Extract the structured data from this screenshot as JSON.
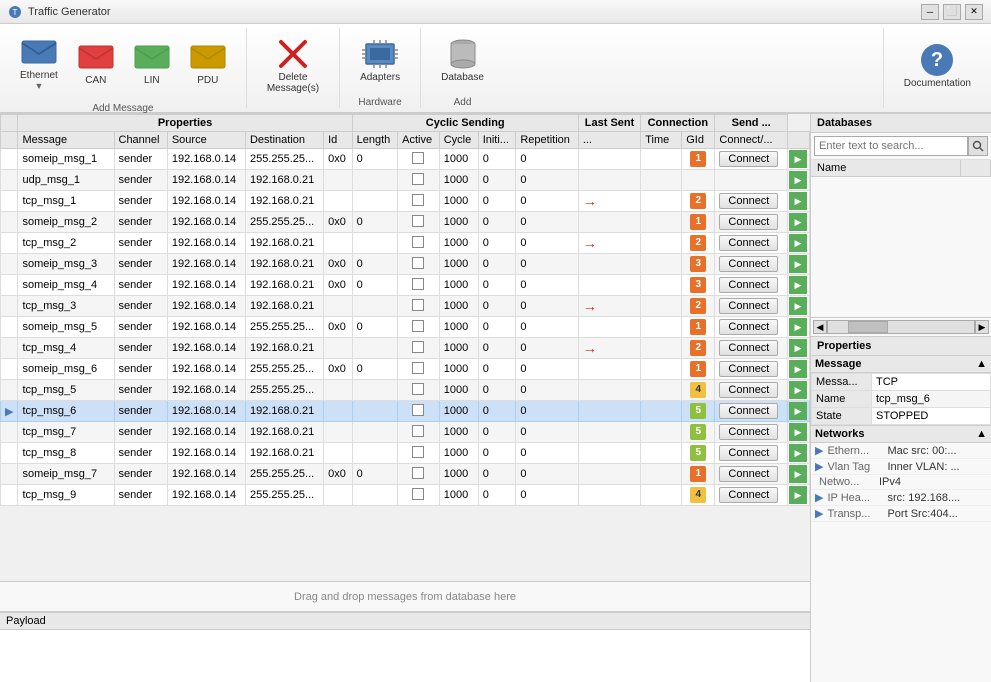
{
  "app": {
    "title": "Traffic Generator"
  },
  "toolbar": {
    "groups": [
      {
        "label": "Add Message",
        "items": [
          {
            "id": "ethernet",
            "label": "Ethernet",
            "icon": "envelope-blue"
          },
          {
            "id": "can",
            "label": "CAN",
            "icon": "envelope-red"
          },
          {
            "id": "lin",
            "label": "LIN",
            "icon": "envelope-green"
          },
          {
            "id": "pdu",
            "label": "PDU",
            "icon": "envelope-yellow"
          }
        ]
      },
      {
        "label": "",
        "items": [
          {
            "id": "delete",
            "label": "Delete\nMessage(s)",
            "icon": "delete-x"
          }
        ]
      },
      {
        "label": "Hardware",
        "items": [
          {
            "id": "adapters",
            "label": "Adapters",
            "icon": "adapters-chip"
          }
        ]
      },
      {
        "label": "Add",
        "items": [
          {
            "id": "database",
            "label": "Database",
            "icon": "database-cylinder"
          }
        ]
      }
    ],
    "docs_label": "Documentation"
  },
  "table": {
    "col_groups": [
      {
        "label": "Properties",
        "colspan": 5
      },
      {
        "label": "Cyclic Sending",
        "colspan": 5
      },
      {
        "label": "Last Sent",
        "colspan": 1
      },
      {
        "label": "Connection",
        "colspan": 2
      },
      {
        "label": "Send ...",
        "colspan": 1
      }
    ],
    "columns": [
      "Message",
      "Channel",
      "Source",
      "Destination",
      "Id",
      "Length",
      "Active",
      "Cycle",
      "Initi...",
      "Repetition",
      "...",
      "Time",
      "GId",
      "Connect/...",
      ""
    ],
    "rows": [
      {
        "name": "someip_msg_1",
        "channel": "sender",
        "src": "192.168.0.14",
        "dst": "255.255.25...",
        "id": "0x0",
        "length": "0",
        "active": false,
        "cycle": "1000",
        "init": "0",
        "rep": "0",
        "dot": "",
        "time": "",
        "gid": 1,
        "gid_class": "gid-1",
        "connect": true,
        "arrow": false,
        "selected": false
      },
      {
        "name": "udp_msg_1",
        "channel": "sender",
        "src": "192.168.0.14",
        "dst": "192.168.0.21",
        "id": "",
        "length": "",
        "active": false,
        "cycle": "1000",
        "init": "0",
        "rep": "0",
        "dot": "",
        "time": "",
        "gid": null,
        "gid_class": "",
        "connect": false,
        "arrow": false,
        "selected": false
      },
      {
        "name": "tcp_msg_1",
        "channel": "sender",
        "src": "192.168.0.14",
        "dst": "192.168.0.21",
        "id": "",
        "length": "",
        "active": false,
        "cycle": "1000",
        "init": "0",
        "rep": "0",
        "dot": "",
        "time": "",
        "gid": 2,
        "gid_class": "gid-2",
        "connect": true,
        "arrow": true,
        "selected": false
      },
      {
        "name": "someip_msg_2",
        "channel": "sender",
        "src": "192.168.0.14",
        "dst": "255.255.25...",
        "id": "0x0",
        "length": "0",
        "active": false,
        "cycle": "1000",
        "init": "0",
        "rep": "0",
        "dot": "",
        "time": "",
        "gid": 1,
        "gid_class": "gid-1",
        "connect": true,
        "arrow": false,
        "selected": false
      },
      {
        "name": "tcp_msg_2",
        "channel": "sender",
        "src": "192.168.0.14",
        "dst": "192.168.0.21",
        "id": "",
        "length": "",
        "active": false,
        "cycle": "1000",
        "init": "0",
        "rep": "0",
        "dot": "",
        "time": "",
        "gid": 2,
        "gid_class": "gid-2",
        "connect": true,
        "arrow": true,
        "selected": false
      },
      {
        "name": "someip_msg_3",
        "channel": "sender",
        "src": "192.168.0.14",
        "dst": "192.168.0.21",
        "id": "0x0",
        "length": "0",
        "active": false,
        "cycle": "1000",
        "init": "0",
        "rep": "0",
        "dot": "",
        "time": "",
        "gid": 3,
        "gid_class": "gid-3",
        "connect": true,
        "arrow": false,
        "selected": false
      },
      {
        "name": "someip_msg_4",
        "channel": "sender",
        "src": "192.168.0.14",
        "dst": "192.168.0.21",
        "id": "0x0",
        "length": "0",
        "active": false,
        "cycle": "1000",
        "init": "0",
        "rep": "0",
        "dot": "",
        "time": "",
        "gid": 3,
        "gid_class": "gid-3",
        "connect": true,
        "arrow": false,
        "selected": false
      },
      {
        "name": "tcp_msg_3",
        "channel": "sender",
        "src": "192.168.0.14",
        "dst": "192.168.0.21",
        "id": "",
        "length": "",
        "active": false,
        "cycle": "1000",
        "init": "0",
        "rep": "0",
        "dot": "",
        "time": "",
        "gid": 2,
        "gid_class": "gid-2",
        "connect": true,
        "arrow": true,
        "selected": false
      },
      {
        "name": "someip_msg_5",
        "channel": "sender",
        "src": "192.168.0.14",
        "dst": "255.255.25...",
        "id": "0x0",
        "length": "0",
        "active": false,
        "cycle": "1000",
        "init": "0",
        "rep": "0",
        "dot": "",
        "time": "",
        "gid": 1,
        "gid_class": "gid-1",
        "connect": true,
        "arrow": false,
        "selected": false
      },
      {
        "name": "tcp_msg_4",
        "channel": "sender",
        "src": "192.168.0.14",
        "dst": "192.168.0.21",
        "id": "",
        "length": "",
        "active": false,
        "cycle": "1000",
        "init": "0",
        "rep": "0",
        "dot": "",
        "time": "",
        "gid": 2,
        "gid_class": "gid-2",
        "connect": true,
        "arrow": true,
        "selected": false
      },
      {
        "name": "someip_msg_6",
        "channel": "sender",
        "src": "192.168.0.14",
        "dst": "255.255.25...",
        "id": "0x0",
        "length": "0",
        "active": false,
        "cycle": "1000",
        "init": "0",
        "rep": "0",
        "dot": "",
        "time": "",
        "gid": 1,
        "gid_class": "gid-1",
        "connect": true,
        "arrow": false,
        "selected": false
      },
      {
        "name": "tcp_msg_5",
        "channel": "sender",
        "src": "192.168.0.14",
        "dst": "255.255.25...",
        "id": "",
        "length": "",
        "active": false,
        "cycle": "1000",
        "init": "0",
        "rep": "0",
        "dot": "",
        "time": "",
        "gid": 4,
        "gid_class": "gid-4",
        "connect": true,
        "arrow": false,
        "selected": false
      },
      {
        "name": "tcp_msg_6",
        "channel": "sender",
        "src": "192.168.0.14",
        "dst": "192.168.0.21",
        "id": "",
        "length": "",
        "active": false,
        "cycle": "1000",
        "init": "0",
        "rep": "0",
        "dot": "",
        "time": "",
        "gid": 5,
        "gid_class": "gid-5",
        "connect": true,
        "arrow": false,
        "selected": true
      },
      {
        "name": "tcp_msg_7",
        "channel": "sender",
        "src": "192.168.0.14",
        "dst": "192.168.0.21",
        "id": "",
        "length": "",
        "active": false,
        "cycle": "1000",
        "init": "0",
        "rep": "0",
        "dot": "",
        "time": "",
        "gid": 5,
        "gid_class": "gid-5",
        "connect": true,
        "arrow": false,
        "selected": false
      },
      {
        "name": "tcp_msg_8",
        "channel": "sender",
        "src": "192.168.0.14",
        "dst": "192.168.0.21",
        "id": "",
        "length": "",
        "active": false,
        "cycle": "1000",
        "init": "0",
        "rep": "0",
        "dot": "",
        "time": "",
        "gid": 5,
        "gid_class": "gid-5",
        "connect": true,
        "arrow": false,
        "selected": false
      },
      {
        "name": "someip_msg_7",
        "channel": "sender",
        "src": "192.168.0.14",
        "dst": "255.255.25...",
        "id": "0x0",
        "length": "0",
        "active": false,
        "cycle": "1000",
        "init": "0",
        "rep": "0",
        "dot": "",
        "time": "",
        "gid": 1,
        "gid_class": "gid-1",
        "connect": true,
        "arrow": false,
        "selected": false
      },
      {
        "name": "tcp_msg_9",
        "channel": "sender",
        "src": "192.168.0.14",
        "dst": "255.255.25...",
        "id": "",
        "length": "",
        "active": false,
        "cycle": "1000",
        "init": "0",
        "rep": "0",
        "dot": "",
        "time": "",
        "gid": 4,
        "gid_class": "gid-4",
        "connect": true,
        "arrow": false,
        "selected": false
      }
    ]
  },
  "drag_drop_label": "Drag and drop messages from database here",
  "payload_label": "Payload",
  "databases": {
    "header": "Databases",
    "search_placeholder": "Enter text to search...",
    "columns": [
      "Name",
      ""
    ],
    "items": []
  },
  "properties": {
    "header": "Properties",
    "message_header": "Message",
    "message_fields": [
      {
        "label": "Messa...",
        "value": "TCP"
      },
      {
        "label": "Name",
        "value": "tcp_msg_6"
      },
      {
        "label": "State",
        "value": "STOPPED"
      }
    ],
    "networks_header": "Networks",
    "network_items": [
      {
        "expand": true,
        "label": "Ethern...",
        "value": "Mac src: 00:..."
      },
      {
        "expand": true,
        "label": "Vlan Tag",
        "value": "Inner VLAN: ..."
      },
      {
        "expand": false,
        "label": "Netwo...",
        "value": "IPv4"
      },
      {
        "expand": true,
        "label": "IP Hea...",
        "value": "src: 192.168...."
      },
      {
        "expand": true,
        "label": "Transp...",
        "value": "Port Src:404..."
      }
    ]
  }
}
